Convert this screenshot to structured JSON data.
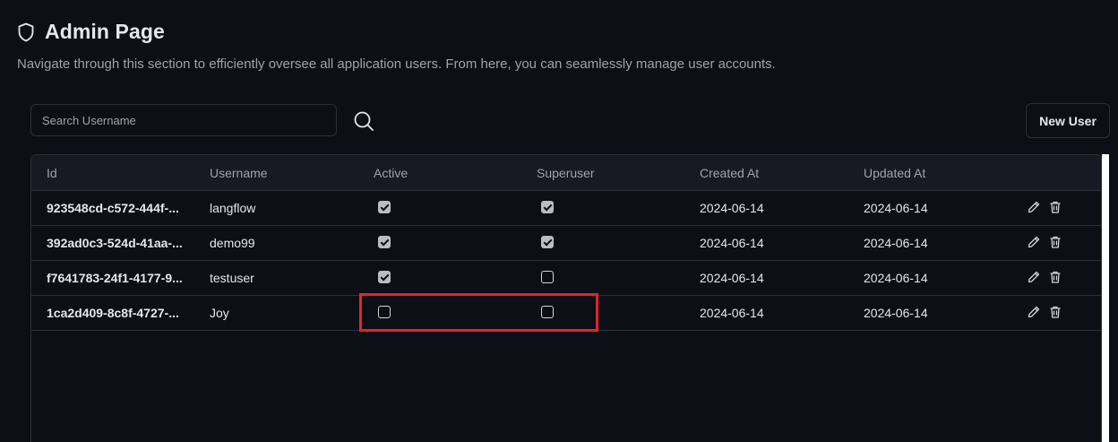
{
  "header": {
    "title": "Admin Page",
    "subtitle": "Navigate through this section to efficiently oversee all application users. From here, you can seamlessly manage user accounts.",
    "icon": "shield-icon"
  },
  "toolbar": {
    "search_placeholder": "Search Username",
    "search_value": "",
    "search_icon": "search-icon",
    "new_user_label": "New User"
  },
  "table": {
    "columns": [
      "Id",
      "Username",
      "Active",
      "Superuser",
      "Created At",
      "Updated At"
    ],
    "rows": [
      {
        "id": "923548cd-c572-444f-...",
        "username": "langflow",
        "active": true,
        "superuser": true,
        "created_at": "2024-06-14",
        "updated_at": "2024-06-14"
      },
      {
        "id": "392ad0c3-524d-41aa-...",
        "username": "demo99",
        "active": true,
        "superuser": true,
        "created_at": "2024-06-14",
        "updated_at": "2024-06-14"
      },
      {
        "id": "f7641783-24f1-4177-9...",
        "username": "testuser",
        "active": true,
        "superuser": false,
        "created_at": "2024-06-14",
        "updated_at": "2024-06-14"
      },
      {
        "id": "1ca2d409-8c8f-4727-...",
        "username": "Joy",
        "active": false,
        "superuser": false,
        "created_at": "2024-06-14",
        "updated_at": "2024-06-14"
      }
    ],
    "row_actions": [
      "pencil-icon",
      "trash-icon"
    ]
  },
  "colors": {
    "background": "#0d0f16",
    "header_row": "#171a22",
    "border": "#2a2f3a",
    "text": "#e5e7eb",
    "muted_text": "#9ca3af",
    "highlight": "#e3242b"
  }
}
